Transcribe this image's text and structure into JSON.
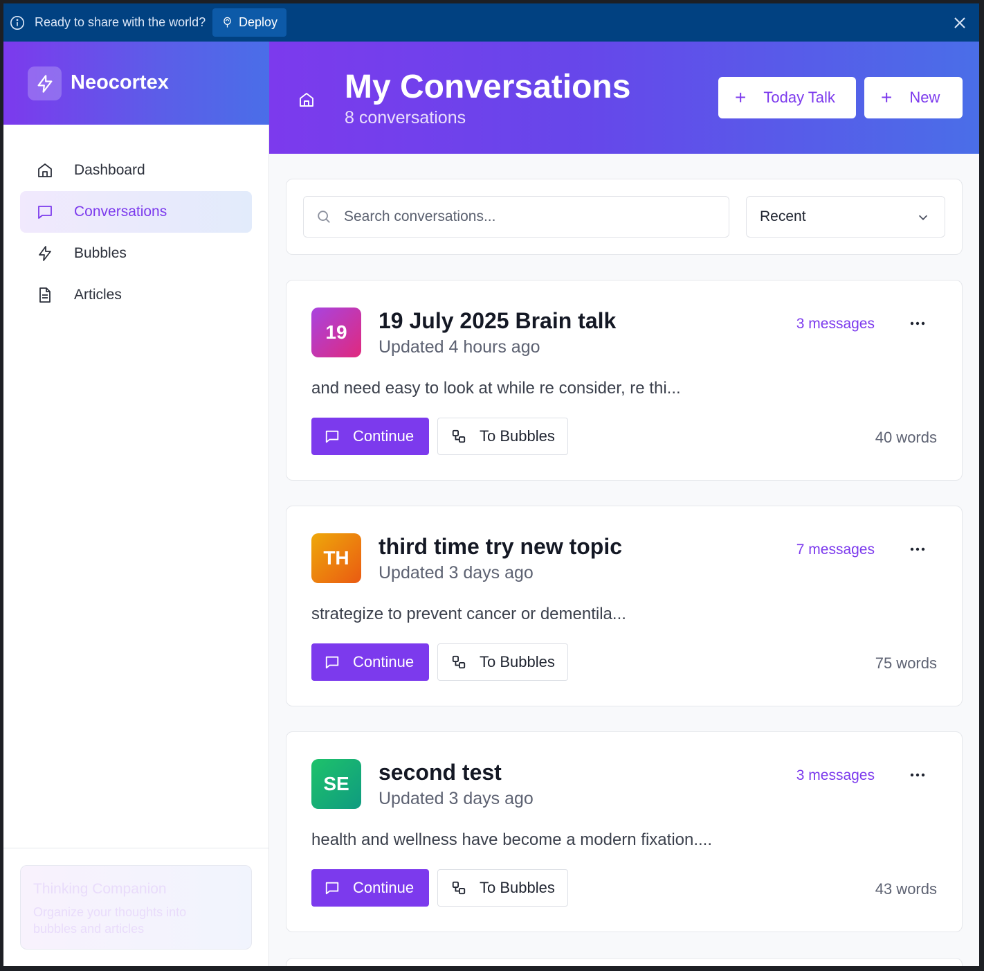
{
  "banner": {
    "text": "Ready to share with the world?",
    "deploy_label": "Deploy"
  },
  "sidebar": {
    "brand": "Neocortex",
    "items": [
      {
        "label": "Dashboard",
        "icon": "home-icon",
        "active": false
      },
      {
        "label": "Conversations",
        "icon": "chat-bubble-icon",
        "active": true
      },
      {
        "label": "Bubbles",
        "icon": "lightning-icon",
        "active": false
      },
      {
        "label": "Articles",
        "icon": "document-icon",
        "active": false
      }
    ],
    "companion": {
      "title": "Thinking Companion",
      "subtitle": "Organize your thoughts into bubbles and articles"
    }
  },
  "header": {
    "title": "My Conversations",
    "subtitle": "8 conversations",
    "today_talk_label": "Today Talk",
    "new_label": "New"
  },
  "search": {
    "placeholder": "Search conversations...",
    "sort_value": "Recent"
  },
  "colors": {
    "accent": "#7c3aed",
    "banner": "#014181"
  },
  "conversations": [
    {
      "initials": "19",
      "title": "19 July 2025 Brain talk",
      "updated": "Updated 4 hours ago",
      "messages": "3 messages",
      "preview": "and need easy to look at while re consider, re thi...",
      "continue_label": "Continue",
      "bubbles_label": "To Bubbles",
      "words": "40 words",
      "avatar_gradient": [
        "#a844e0",
        "#e0297d"
      ]
    },
    {
      "initials": "TH",
      "title": "third time try new topic",
      "updated": "Updated 3 days ago",
      "messages": "7 messages",
      "preview": "strategize to prevent cancer or dementila...",
      "continue_label": "Continue",
      "bubbles_label": "To Bubbles",
      "words": "75 words",
      "avatar_gradient": [
        "#eea80a",
        "#ea5a12"
      ]
    },
    {
      "initials": "SE",
      "title": "second test",
      "updated": "Updated 3 days ago",
      "messages": "3 messages",
      "preview": "health and wellness have become a modern fixation....",
      "continue_label": "Continue",
      "bubbles_label": "To Bubbles",
      "words": "43 words",
      "avatar_gradient": [
        "#1ec26a",
        "#0f9b80"
      ]
    }
  ]
}
